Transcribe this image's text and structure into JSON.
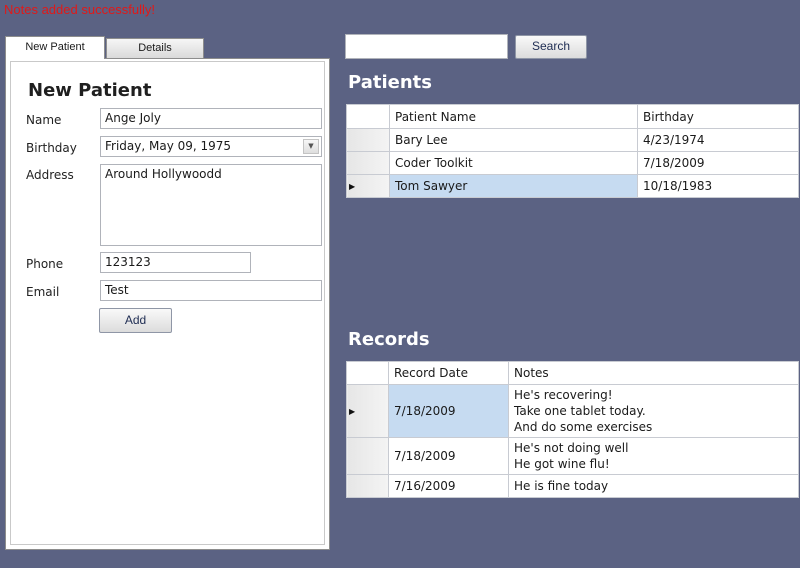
{
  "status_message": "Notes added successfully!",
  "tabs": [
    {
      "label": "New Patient",
      "active": true
    },
    {
      "label": "Details",
      "active": false
    }
  ],
  "form": {
    "title": "New Patient",
    "name_label": "Name",
    "name_value": "Ange Joly",
    "birthday_label": "Birthday",
    "birthday_value": "Friday, May 09, 1975",
    "address_label": "Address",
    "address_value": "Around Hollywoodd",
    "phone_label": "Phone",
    "phone_value": "123123",
    "email_label": "Email",
    "email_value": "Test",
    "add_label": "Add"
  },
  "search": {
    "value": "",
    "button_label": "Search"
  },
  "patients": {
    "title": "Patients",
    "columns": [
      "Patient Name",
      "Birthday"
    ],
    "rows": [
      {
        "name": "Bary Lee",
        "birthday": "4/23/1974",
        "selected": false
      },
      {
        "name": "Coder Toolkit",
        "birthday": "7/18/2009",
        "selected": false
      },
      {
        "name": "Tom Sawyer",
        "birthday": "10/18/1983",
        "selected": true
      }
    ]
  },
  "records": {
    "title": "Records",
    "columns": [
      "Record Date",
      "Notes"
    ],
    "rows": [
      {
        "date": "7/18/2009",
        "notes": [
          "He's recovering!",
          "Take one tablet today.",
          "And do some exercises"
        ],
        "selected": true
      },
      {
        "date": "7/18/2009",
        "notes": [
          "He's not doing well",
          "He got wine flu!"
        ],
        "selected": false
      },
      {
        "date": "7/16/2009",
        "notes": [
          "He is fine today"
        ],
        "selected": false
      }
    ]
  },
  "colors": {
    "background": "#5b6283",
    "status_text": "#e01919",
    "selection": "#c6dbf1"
  },
  "icons": {
    "row_pointer": "current-row-arrow-icon",
    "dropdown": "chevron-down-icon"
  }
}
